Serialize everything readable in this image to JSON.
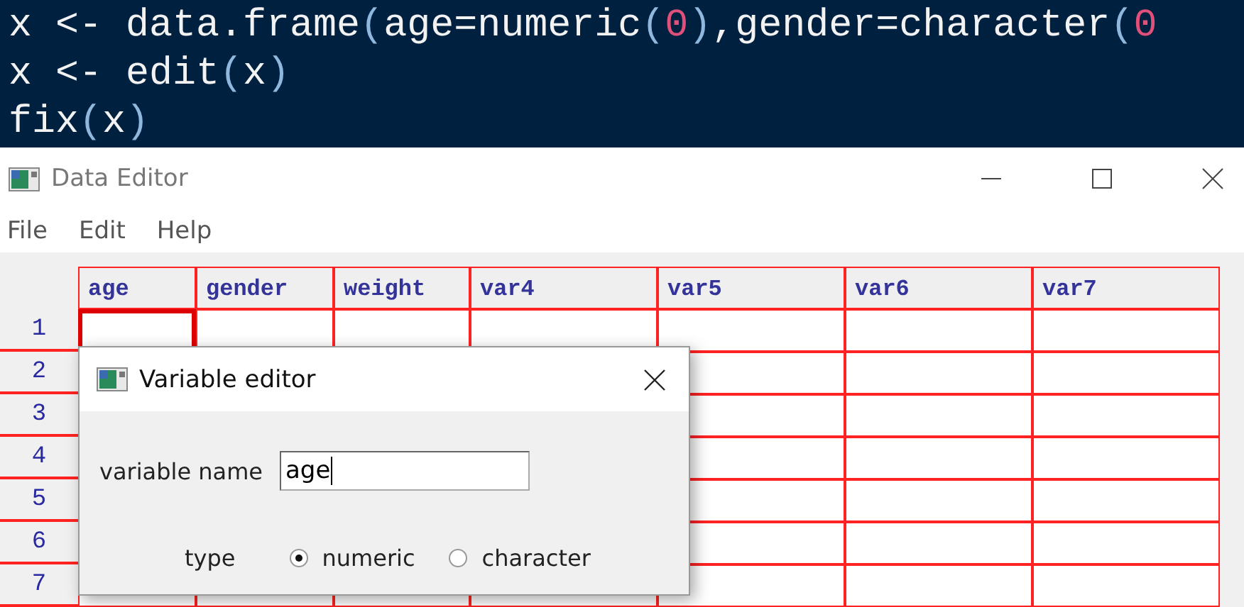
{
  "console": {
    "lines": [
      [
        {
          "kind": "plain",
          "text": "x <- data.frame"
        },
        {
          "kind": "paren",
          "text": "("
        },
        {
          "kind": "plain",
          "text": "age=numeric"
        },
        {
          "kind": "paren",
          "text": "("
        },
        {
          "kind": "number",
          "text": "0"
        },
        {
          "kind": "paren",
          "text": ")"
        },
        {
          "kind": "plain",
          "text": ",gender=character"
        },
        {
          "kind": "paren",
          "text": "("
        },
        {
          "kind": "number",
          "text": "0"
        }
      ],
      [
        {
          "kind": "plain",
          "text": "x <- edit"
        },
        {
          "kind": "paren",
          "text": "("
        },
        {
          "kind": "plain",
          "text": "x"
        },
        {
          "kind": "paren",
          "text": ")"
        }
      ],
      [
        {
          "kind": "plain",
          "text": "fix"
        },
        {
          "kind": "paren",
          "text": "("
        },
        {
          "kind": "plain",
          "text": "x"
        },
        {
          "kind": "paren",
          "text": ")"
        }
      ]
    ]
  },
  "window": {
    "title": "Data Editor"
  },
  "menu": [
    "File",
    "Edit",
    "Help"
  ],
  "table": {
    "columns": [
      "age",
      "gender",
      "weight",
      "var4",
      "var5",
      "var6",
      "var7"
    ],
    "rows": [
      {
        "label": "1",
        "cells": [
          {
            "selected": true
          },
          {
            "selected": false
          },
          {
            "selected": false
          },
          {
            "selected": false
          },
          {
            "selected": false
          },
          {
            "selected": false
          },
          {
            "selected": false
          }
        ]
      },
      {
        "label": "2"
      },
      {
        "label": "3"
      },
      {
        "label": "4"
      },
      {
        "label": "5"
      },
      {
        "label": "6"
      },
      {
        "label": "7"
      }
    ]
  },
  "dialog": {
    "title": "Variable editor",
    "name_label": "variable name",
    "name_value": "age",
    "type_label": "type",
    "types": [
      {
        "label": "numeric",
        "selected": true
      },
      {
        "label": "character",
        "selected": false
      }
    ]
  }
}
